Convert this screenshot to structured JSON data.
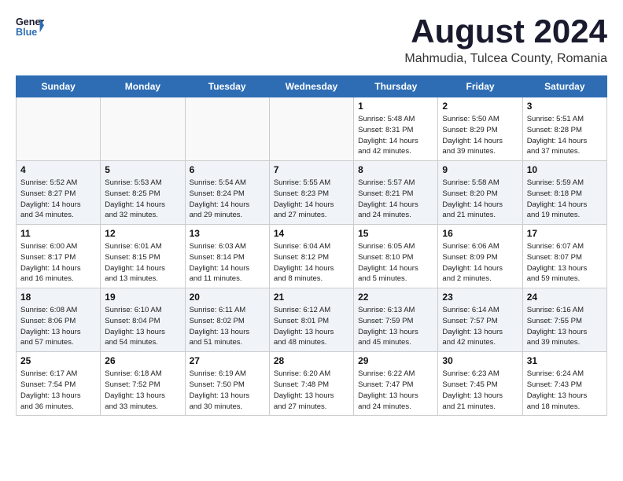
{
  "header": {
    "logo_line1": "General",
    "logo_line2": "Blue",
    "month_year": "August 2024",
    "location": "Mahmudia, Tulcea County, Romania"
  },
  "days_of_week": [
    "Sunday",
    "Monday",
    "Tuesday",
    "Wednesday",
    "Thursday",
    "Friday",
    "Saturday"
  ],
  "weeks": [
    [
      {
        "day": "",
        "info": ""
      },
      {
        "day": "",
        "info": ""
      },
      {
        "day": "",
        "info": ""
      },
      {
        "day": "",
        "info": ""
      },
      {
        "day": "1",
        "info": "Sunrise: 5:48 AM\nSunset: 8:31 PM\nDaylight: 14 hours\nand 42 minutes."
      },
      {
        "day": "2",
        "info": "Sunrise: 5:50 AM\nSunset: 8:29 PM\nDaylight: 14 hours\nand 39 minutes."
      },
      {
        "day": "3",
        "info": "Sunrise: 5:51 AM\nSunset: 8:28 PM\nDaylight: 14 hours\nand 37 minutes."
      }
    ],
    [
      {
        "day": "4",
        "info": "Sunrise: 5:52 AM\nSunset: 8:27 PM\nDaylight: 14 hours\nand 34 minutes."
      },
      {
        "day": "5",
        "info": "Sunrise: 5:53 AM\nSunset: 8:25 PM\nDaylight: 14 hours\nand 32 minutes."
      },
      {
        "day": "6",
        "info": "Sunrise: 5:54 AM\nSunset: 8:24 PM\nDaylight: 14 hours\nand 29 minutes."
      },
      {
        "day": "7",
        "info": "Sunrise: 5:55 AM\nSunset: 8:23 PM\nDaylight: 14 hours\nand 27 minutes."
      },
      {
        "day": "8",
        "info": "Sunrise: 5:57 AM\nSunset: 8:21 PM\nDaylight: 14 hours\nand 24 minutes."
      },
      {
        "day": "9",
        "info": "Sunrise: 5:58 AM\nSunset: 8:20 PM\nDaylight: 14 hours\nand 21 minutes."
      },
      {
        "day": "10",
        "info": "Sunrise: 5:59 AM\nSunset: 8:18 PM\nDaylight: 14 hours\nand 19 minutes."
      }
    ],
    [
      {
        "day": "11",
        "info": "Sunrise: 6:00 AM\nSunset: 8:17 PM\nDaylight: 14 hours\nand 16 minutes."
      },
      {
        "day": "12",
        "info": "Sunrise: 6:01 AM\nSunset: 8:15 PM\nDaylight: 14 hours\nand 13 minutes."
      },
      {
        "day": "13",
        "info": "Sunrise: 6:03 AM\nSunset: 8:14 PM\nDaylight: 14 hours\nand 11 minutes."
      },
      {
        "day": "14",
        "info": "Sunrise: 6:04 AM\nSunset: 8:12 PM\nDaylight: 14 hours\nand 8 minutes."
      },
      {
        "day": "15",
        "info": "Sunrise: 6:05 AM\nSunset: 8:10 PM\nDaylight: 14 hours\nand 5 minutes."
      },
      {
        "day": "16",
        "info": "Sunrise: 6:06 AM\nSunset: 8:09 PM\nDaylight: 14 hours\nand 2 minutes."
      },
      {
        "day": "17",
        "info": "Sunrise: 6:07 AM\nSunset: 8:07 PM\nDaylight: 13 hours\nand 59 minutes."
      }
    ],
    [
      {
        "day": "18",
        "info": "Sunrise: 6:08 AM\nSunset: 8:06 PM\nDaylight: 13 hours\nand 57 minutes."
      },
      {
        "day": "19",
        "info": "Sunrise: 6:10 AM\nSunset: 8:04 PM\nDaylight: 13 hours\nand 54 minutes."
      },
      {
        "day": "20",
        "info": "Sunrise: 6:11 AM\nSunset: 8:02 PM\nDaylight: 13 hours\nand 51 minutes."
      },
      {
        "day": "21",
        "info": "Sunrise: 6:12 AM\nSunset: 8:01 PM\nDaylight: 13 hours\nand 48 minutes."
      },
      {
        "day": "22",
        "info": "Sunrise: 6:13 AM\nSunset: 7:59 PM\nDaylight: 13 hours\nand 45 minutes."
      },
      {
        "day": "23",
        "info": "Sunrise: 6:14 AM\nSunset: 7:57 PM\nDaylight: 13 hours\nand 42 minutes."
      },
      {
        "day": "24",
        "info": "Sunrise: 6:16 AM\nSunset: 7:55 PM\nDaylight: 13 hours\nand 39 minutes."
      }
    ],
    [
      {
        "day": "25",
        "info": "Sunrise: 6:17 AM\nSunset: 7:54 PM\nDaylight: 13 hours\nand 36 minutes."
      },
      {
        "day": "26",
        "info": "Sunrise: 6:18 AM\nSunset: 7:52 PM\nDaylight: 13 hours\nand 33 minutes."
      },
      {
        "day": "27",
        "info": "Sunrise: 6:19 AM\nSunset: 7:50 PM\nDaylight: 13 hours\nand 30 minutes."
      },
      {
        "day": "28",
        "info": "Sunrise: 6:20 AM\nSunset: 7:48 PM\nDaylight: 13 hours\nand 27 minutes."
      },
      {
        "day": "29",
        "info": "Sunrise: 6:22 AM\nSunset: 7:47 PM\nDaylight: 13 hours\nand 24 minutes."
      },
      {
        "day": "30",
        "info": "Sunrise: 6:23 AM\nSunset: 7:45 PM\nDaylight: 13 hours\nand 21 minutes."
      },
      {
        "day": "31",
        "info": "Sunrise: 6:24 AM\nSunset: 7:43 PM\nDaylight: 13 hours\nand 18 minutes."
      }
    ]
  ]
}
